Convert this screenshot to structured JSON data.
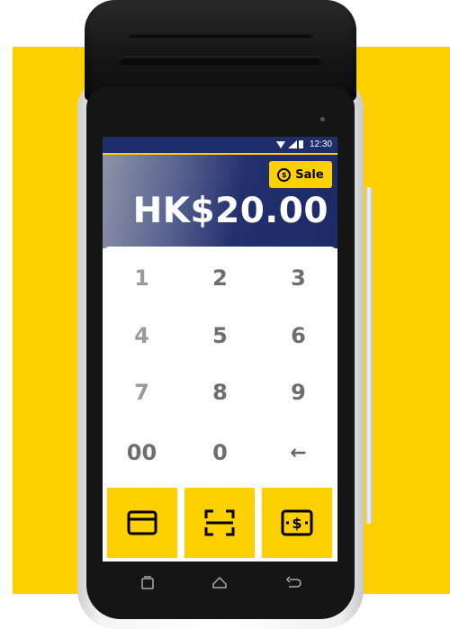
{
  "status_bar": {
    "time": "12:30"
  },
  "header": {
    "sale_label": "Sale",
    "amount": "HK$20.00"
  },
  "keypad": {
    "keys": [
      "1",
      "2",
      "3",
      "4",
      "5",
      "6",
      "7",
      "8",
      "9",
      "00",
      "0",
      "←"
    ]
  },
  "actions": [
    {
      "icon": "card-icon"
    },
    {
      "icon": "scan-icon"
    },
    {
      "icon": "cash-icon"
    }
  ],
  "navbar": {
    "icons": [
      "recents-icon",
      "home-icon",
      "back-icon"
    ]
  },
  "colors": {
    "accent": "#ffd000",
    "header": "#1e2e6d"
  }
}
